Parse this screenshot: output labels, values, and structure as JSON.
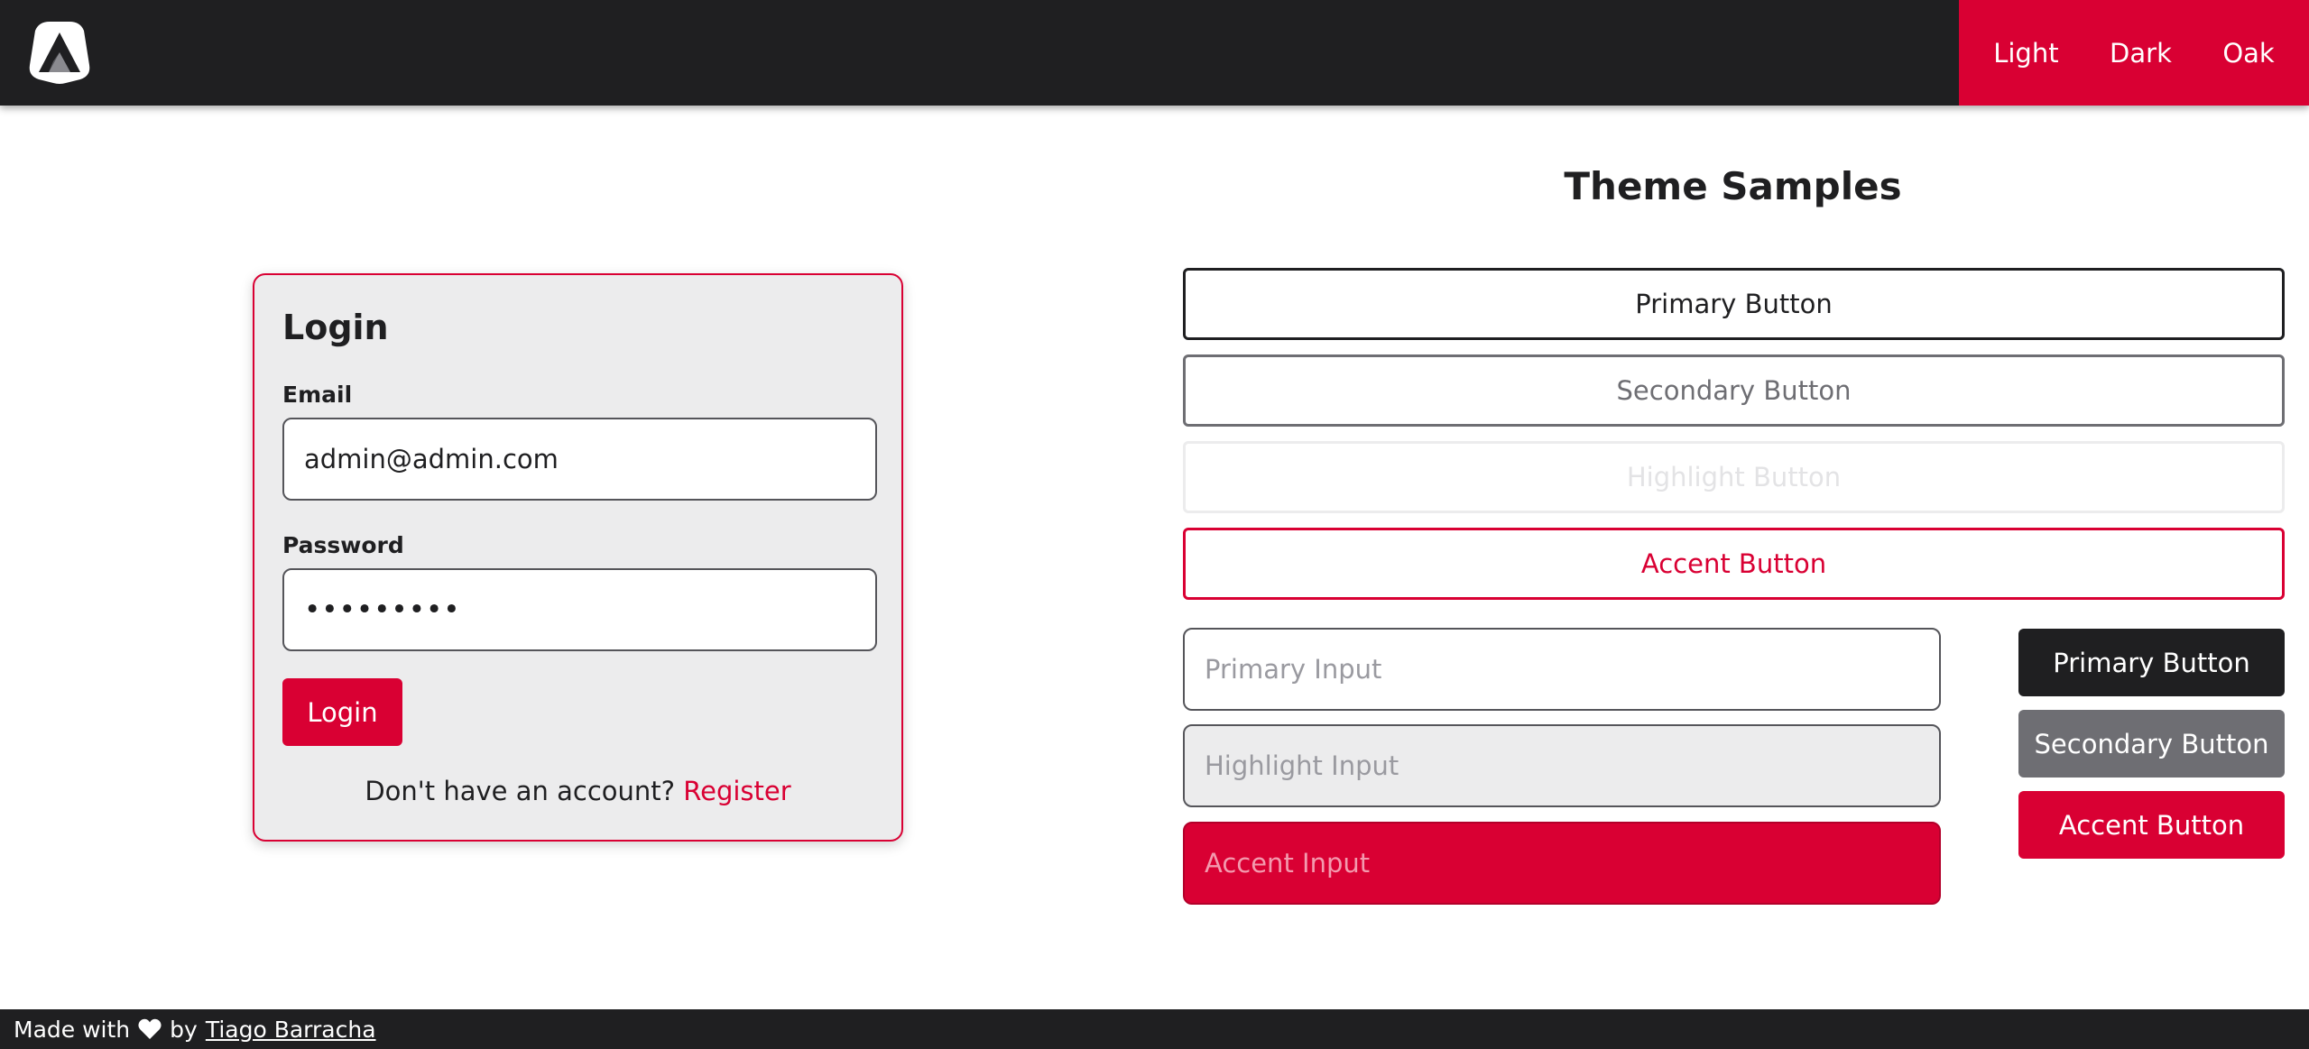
{
  "navbar": {
    "logo_icon": "triangle-logo-icon",
    "themes": [
      "Light",
      "Dark",
      "Oak"
    ]
  },
  "login": {
    "title": "Login",
    "email_label": "Email",
    "email_value": "admin@admin.com",
    "password_label": "Password",
    "password_value": "•••••••••",
    "submit_label": "Login",
    "register_prompt": "Don't have an account?",
    "register_link": "Register"
  },
  "samples": {
    "title": "Theme Samples",
    "outline_buttons": {
      "primary": "Primary Button",
      "secondary": "Secondary Button",
      "highlight": "Highlight Button",
      "accent": "Accent Button"
    },
    "inputs": {
      "primary_placeholder": "Primary Input",
      "highlight_placeholder": "Highlight Input",
      "accent_placeholder": "Accent Input"
    },
    "solid_buttons": {
      "primary": "Primary Button",
      "secondary": "Secondary Button",
      "accent": "Accent Button"
    }
  },
  "footer": {
    "made_with": "Made with",
    "heart_icon": "heart-icon",
    "by": "by",
    "author": "Tiago Barracha"
  },
  "colors": {
    "primary": "#1f1f21",
    "secondary": "#6e6e73",
    "highlight": "#ececed",
    "accent": "#d90033"
  }
}
